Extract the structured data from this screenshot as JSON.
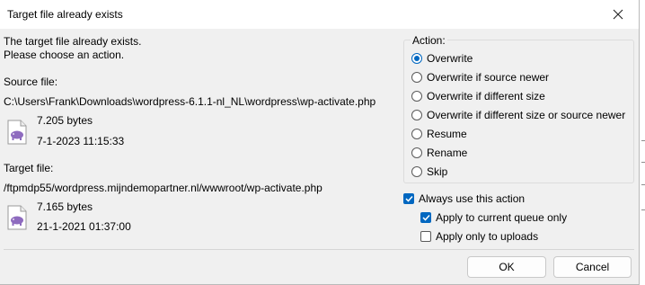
{
  "window": {
    "title": "Target file already exists",
    "close_icon": "close-icon"
  },
  "message": {
    "line1": "The target file already exists.",
    "line2": "Please choose an action."
  },
  "source": {
    "label": "Source file:",
    "path": "C:\\Users\\Frank\\Downloads\\wordpress-6.1.1-nl_NL\\wordpress\\wp-activate.php",
    "size": "7.205 bytes",
    "date": "7-1-2023 11:15:33",
    "icon": "php-file-icon"
  },
  "target": {
    "label": "Target file:",
    "path": "/ftpmdp55/wordpress.mijndemopartner.nl/wwwroot/wp-activate.php",
    "size": "7.165 bytes",
    "date": "21-1-2021 01:37:00",
    "icon": "php-file-icon"
  },
  "action": {
    "label": "Action:",
    "options": [
      {
        "label": "Overwrite",
        "selected": true
      },
      {
        "label": "Overwrite if source newer",
        "selected": false
      },
      {
        "label": "Overwrite if different size",
        "selected": false
      },
      {
        "label": "Overwrite if different size or source newer",
        "selected": false
      },
      {
        "label": "Resume",
        "selected": false
      },
      {
        "label": "Rename",
        "selected": false
      },
      {
        "label": "Skip",
        "selected": false
      }
    ]
  },
  "checks": {
    "always": {
      "label": "Always use this action",
      "checked": true
    },
    "queue": {
      "label": "Apply to current queue only",
      "checked": true
    },
    "uploads": {
      "label": "Apply only to uploads",
      "checked": false
    }
  },
  "buttons": {
    "ok": "OK",
    "cancel": "Cancel"
  },
  "colors": {
    "accent": "#0067c0",
    "icon_purple": "#8e6bbf"
  }
}
